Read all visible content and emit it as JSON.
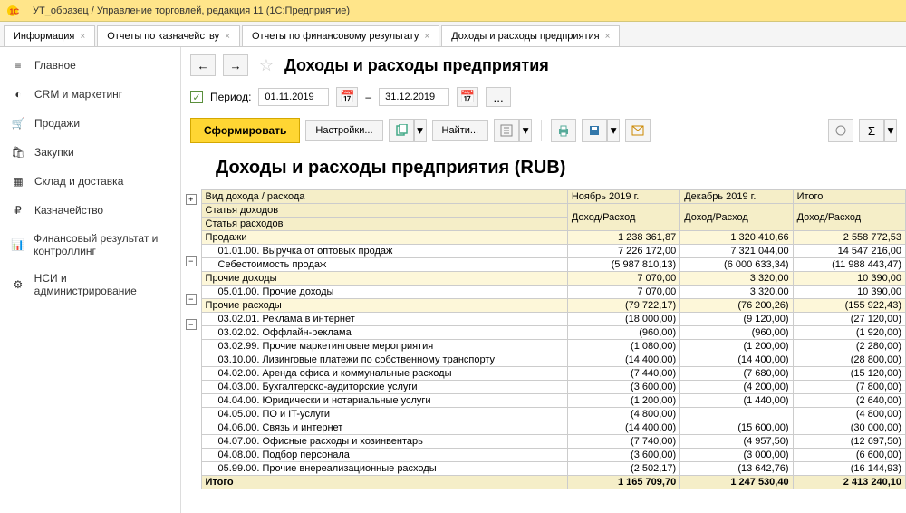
{
  "window": {
    "title": "УТ_образец / Управление торговлей, редакция 11  (1С:Предприятие)"
  },
  "tabs": {
    "t0": "Информация",
    "t1": "Отчеты по казначейству",
    "t2": "Отчеты по финансовому результату",
    "t3": "Доходы и расходы предприятия"
  },
  "sidebar": {
    "main": "Главное",
    "crm": "CRM и маркетинг",
    "sales": "Продажи",
    "purch": "Закупки",
    "wh": "Склад и доставка",
    "treasury": "Казначейство",
    "fin": "Финансовый результат и контроллинг",
    "nsi": "НСИ и администрирование"
  },
  "page": {
    "title": "Доходы и расходы предприятия"
  },
  "period": {
    "label": "Период:",
    "from": "01.11.2019",
    "to": "31.12.2019",
    "sep": "–"
  },
  "toolbar": {
    "run": "Сформировать",
    "settings": "Настройки...",
    "find": "Найти..."
  },
  "report": {
    "title": "Доходы и расходы предприятия (RUB)",
    "h_name": "Вид дохода / расхода",
    "h_row2": "Статья доходов",
    "h_row3": "Статья расходов",
    "h_nov": "Ноябрь 2019 г.",
    "h_dec": "Декабрь 2019 г.",
    "h_tot": "Итого",
    "h_sub": "Доход/Расход",
    "rows": [
      {
        "c": "grp",
        "n": "Продажи",
        "v1": "1 238 361,87",
        "v2": "1 320 410,66",
        "v3": "2 558 772,53"
      },
      {
        "c": "sub",
        "i": 1,
        "n": "01.01.00. Выручка от оптовых продаж",
        "v1": "7 226 172,00",
        "v2": "7 321 044,00",
        "v3": "14 547 216,00"
      },
      {
        "c": "sub",
        "i": 1,
        "n": "Себестоимость продаж",
        "v1": "(5 987 810,13)",
        "v2": "(6 000 633,34)",
        "v3": "(11 988 443,47)"
      },
      {
        "c": "grp",
        "n": "Прочие доходы",
        "v1": "7 070,00",
        "v2": "3 320,00",
        "v3": "10 390,00"
      },
      {
        "c": "sub",
        "i": 1,
        "n": "05.01.00. Прочие доходы",
        "v1": "7 070,00",
        "v2": "3 320,00",
        "v3": "10 390,00"
      },
      {
        "c": "grp",
        "n": "Прочие расходы",
        "v1": "(79 722,17)",
        "v2": "(76 200,26)",
        "v3": "(155 922,43)"
      },
      {
        "c": "sub",
        "i": 1,
        "n": "03.02.01. Реклама в интернет",
        "v1": "(18 000,00)",
        "v2": "(9 120,00)",
        "v3": "(27 120,00)"
      },
      {
        "c": "sub",
        "i": 1,
        "n": "03.02.02. Оффлайн-реклама",
        "v1": "(960,00)",
        "v2": "(960,00)",
        "v3": "(1 920,00)"
      },
      {
        "c": "sub",
        "i": 1,
        "n": "03.02.99. Прочие маркетинговые мероприятия",
        "v1": "(1 080,00)",
        "v2": "(1 200,00)",
        "v3": "(2 280,00)"
      },
      {
        "c": "sub",
        "i": 1,
        "n": "03.10.00. Лизинговые платежи по собственному транспорту",
        "v1": "(14 400,00)",
        "v2": "(14 400,00)",
        "v3": "(28 800,00)"
      },
      {
        "c": "sub",
        "i": 1,
        "n": "04.02.00. Аренда офиса и коммунальные расходы",
        "v1": "(7 440,00)",
        "v2": "(7 680,00)",
        "v3": "(15 120,00)"
      },
      {
        "c": "sub",
        "i": 1,
        "n": "04.03.00. Бухгалтерско-аудиторские услуги",
        "v1": "(3 600,00)",
        "v2": "(4 200,00)",
        "v3": "(7 800,00)"
      },
      {
        "c": "sub",
        "i": 1,
        "n": "04.04.00. Юридически и нотариальные услуги",
        "v1": "(1 200,00)",
        "v2": "(1 440,00)",
        "v3": "(2 640,00)"
      },
      {
        "c": "sub",
        "i": 1,
        "n": "04.05.00. ПО и IT-услуги",
        "v1": "(4 800,00)",
        "v2": "",
        "v3": "(4 800,00)"
      },
      {
        "c": "sub",
        "i": 1,
        "n": "04.06.00. Связь и интернет",
        "v1": "(14 400,00)",
        "v2": "(15 600,00)",
        "v3": "(30 000,00)"
      },
      {
        "c": "sub",
        "i": 1,
        "n": "04.07.00. Офисные расходы и хозинвентарь",
        "v1": "(7 740,00)",
        "v2": "(4 957,50)",
        "v3": "(12 697,50)"
      },
      {
        "c": "sub",
        "i": 1,
        "n": "04.08.00. Подбор персонала",
        "v1": "(3 600,00)",
        "v2": "(3 000,00)",
        "v3": "(6 600,00)"
      },
      {
        "c": "sub",
        "i": 1,
        "n": "05.99.00. Прочие внереализационные расходы",
        "v1": "(2 502,17)",
        "v2": "(13 642,76)",
        "v3": "(16 144,93)"
      },
      {
        "c": "total",
        "n": "Итого",
        "v1": "1 165 709,70",
        "v2": "1 247 530,40",
        "v3": "2 413 240,10"
      }
    ]
  }
}
